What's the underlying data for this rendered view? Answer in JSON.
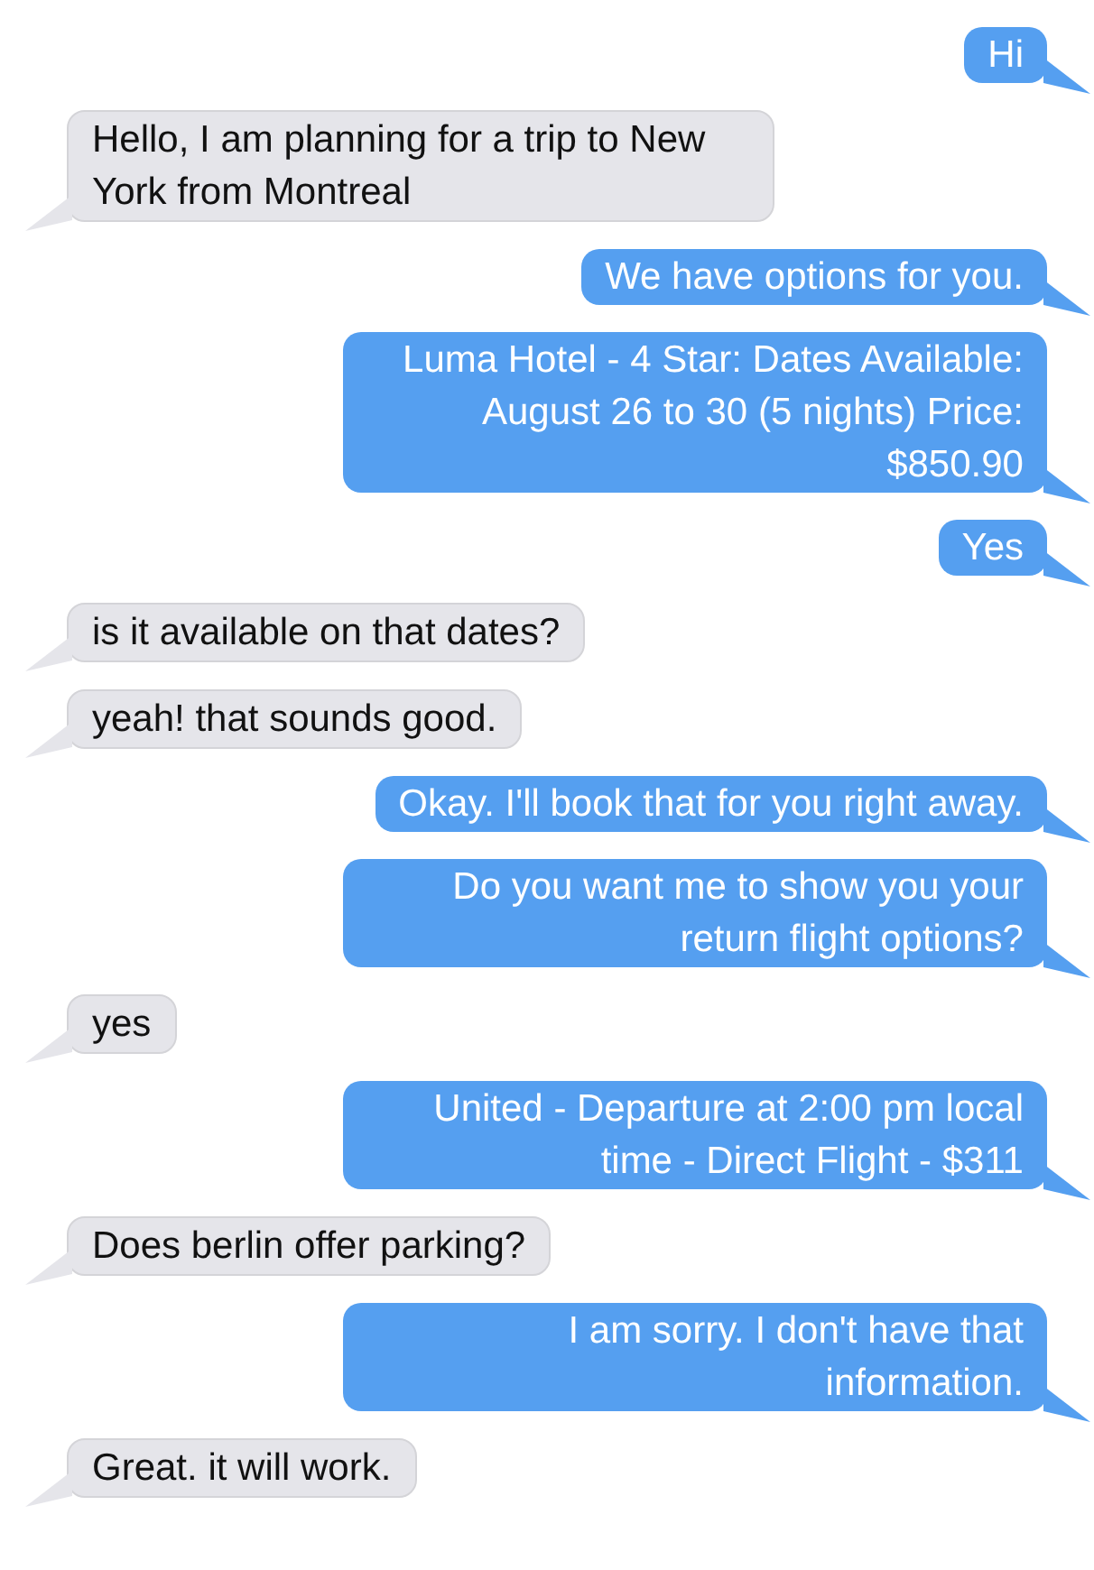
{
  "messages": [
    {
      "kind": "outgoing",
      "text": "Hi"
    },
    {
      "kind": "incoming",
      "text": "Hello, I am planning for a trip to New York from Montreal"
    },
    {
      "kind": "outgoing",
      "text": "We have options for you."
    },
    {
      "kind": "outgoing",
      "text": "Luma Hotel - 4 Star: Dates Available: August 26 to 30 (5 nights) Price: $850.90"
    },
    {
      "kind": "outgoing",
      "text": "Yes"
    },
    {
      "kind": "incoming",
      "text": "is it available on that dates?"
    },
    {
      "kind": "incoming",
      "text": "yeah! that sounds good."
    },
    {
      "kind": "outgoing",
      "text": "Okay. I'll book that for you right away."
    },
    {
      "kind": "outgoing",
      "text": "Do you want me to show you your return flight options?"
    },
    {
      "kind": "incoming",
      "text": "yes"
    },
    {
      "kind": "outgoing",
      "text": "United - Departure at 2:00 pm local time - Direct Flight - $311"
    },
    {
      "kind": "incoming",
      "text": "Does berlin offer parking?"
    },
    {
      "kind": "outgoing",
      "text": "I am sorry. I don't have that information."
    },
    {
      "kind": "incoming",
      "text": "Great. it will work."
    }
  ]
}
